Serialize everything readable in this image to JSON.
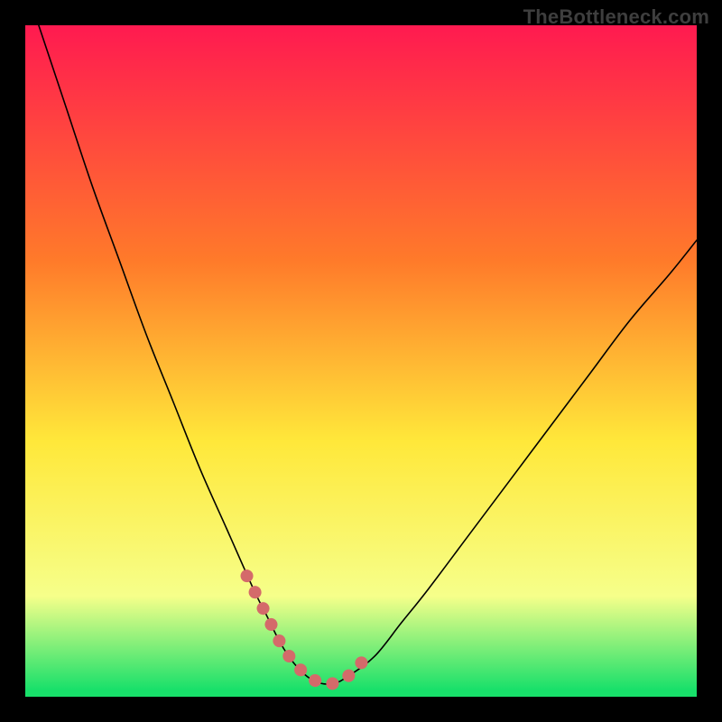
{
  "watermark": "TheBottleneck.com",
  "chart_data": {
    "type": "line",
    "title": "",
    "xlabel": "",
    "ylabel": "",
    "xlim": [
      0,
      100
    ],
    "ylim": [
      0,
      100
    ],
    "series": [
      {
        "name": "curve",
        "x": [
          2,
          6,
          10,
          14,
          18,
          22,
          26,
          30,
          34,
          36,
          38,
          40,
          42,
          44,
          46,
          48,
          52,
          56,
          60,
          66,
          72,
          78,
          84,
          90,
          96,
          100
        ],
        "y": [
          100,
          88,
          76,
          65,
          54,
          44,
          34,
          25,
          16,
          12,
          8,
          5,
          3,
          2,
          2,
          3,
          6,
          11,
          16,
          24,
          32,
          40,
          48,
          56,
          63,
          68
        ]
      },
      {
        "name": "highlight",
        "x": [
          33,
          34,
          35,
          36,
          37,
          38,
          39,
          40,
          41,
          42,
          43,
          44,
          45,
          46,
          47,
          48,
          49,
          50,
          51
        ],
        "y": [
          18,
          16,
          14,
          12,
          10,
          8,
          6.5,
          5,
          4,
          3,
          2.5,
          2,
          2,
          2,
          2.5,
          3,
          4,
          5,
          6
        ]
      }
    ],
    "background_gradient": {
      "top": "#ff1a50",
      "mid1": "#ff7a2a",
      "mid2": "#ffe83a",
      "low": "#f6ff8a",
      "bottom": "#18e06a"
    },
    "highlight_color": "#d46a6a",
    "curve_color": "#000000"
  }
}
